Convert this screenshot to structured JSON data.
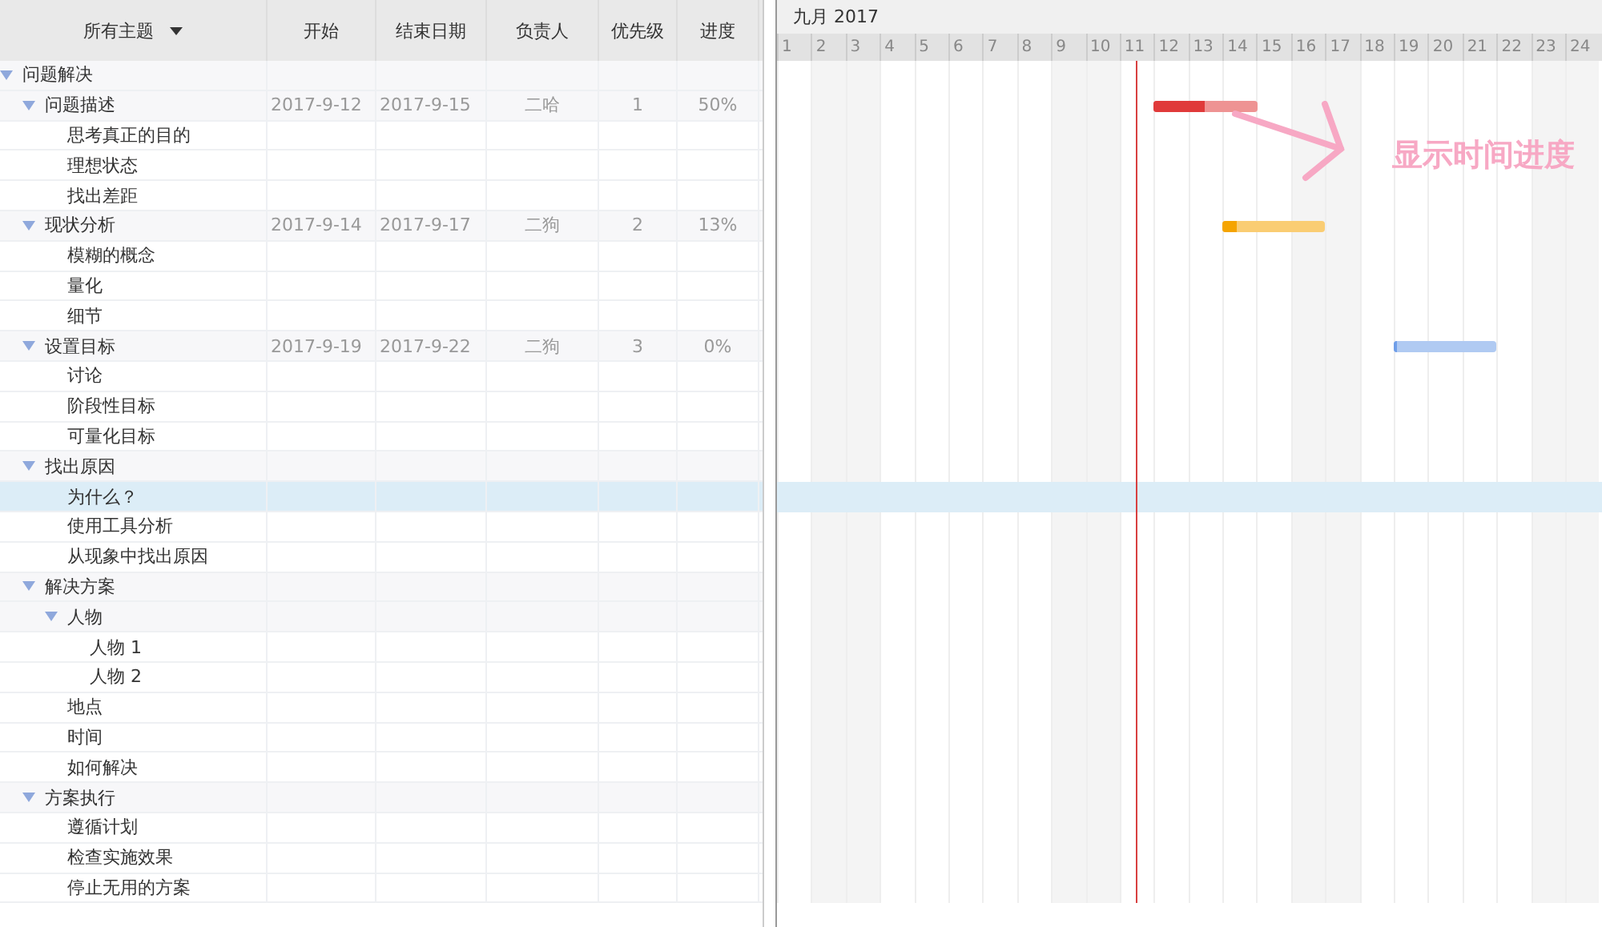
{
  "columns": [
    {
      "label": "所有主题",
      "menu": true
    },
    {
      "label": "开始"
    },
    {
      "label": "结束日期"
    },
    {
      "label": "负责人"
    },
    {
      "label": "优先级"
    },
    {
      "label": "进度"
    }
  ],
  "rows": [
    {
      "name": "问题解决",
      "expanded": true,
      "selected": false,
      "children": [
        {
          "name": "问题描述",
          "expanded": true,
          "selected": false,
          "start": "2017-9-12",
          "end": "2017-9-15",
          "owner": "二哈",
          "priority": "1",
          "progress": "50%",
          "bar": {
            "level": 0.5,
            "color": "#e03a3a"
          },
          "children": [
            {
              "name": "思考真正的目的",
              "selected": false
            },
            {
              "name": "理想状态",
              "selected": false
            },
            {
              "name": "找出差距",
              "selected": false
            }
          ]
        },
        {
          "name": "现状分析",
          "expanded": true,
          "selected": false,
          "start": "2017-9-14",
          "end": "2017-9-17",
          "owner": "二狗",
          "priority": "2",
          "progress": "13%",
          "bar": {
            "level": 0.13,
            "color": "#f5a400"
          },
          "children": [
            {
              "name": " 模糊的概念",
              "selected": false
            },
            {
              "name": "量化",
              "selected": false
            },
            {
              "name": "细节",
              "selected": false
            }
          ]
        },
        {
          "name": "设置目标",
          "expanded": true,
          "selected": false,
          "start": "2017-9-19",
          "end": "2017-9-22",
          "owner": "二狗",
          "priority": "3",
          "progress": "0%",
          "bar": {
            "level": 0,
            "color": "#6f9ee8"
          },
          "children": [
            {
              "name": "讨论",
              "selected": false
            },
            {
              "name": "阶段性目标",
              "selected": false
            },
            {
              "name": "可量化目标",
              "selected": false
            }
          ]
        },
        {
          "name": "找出原因",
          "expanded": true,
          "selected": false,
          "children": [
            {
              "name": "为什么？",
              "selected": true
            },
            {
              "name": "使用工具分析",
              "selected": false
            },
            {
              "name": "从现象中找出原因",
              "selected": false
            }
          ]
        },
        {
          "name": "解决方案",
          "expanded": true,
          "selected": false,
          "children": [
            {
              "name": "人物",
              "expanded": true,
              "selected": false,
              "children": [
                {
                  "name": "人物 1",
                  "selected": false
                },
                {
                  "name": "人物 2",
                  "selected": false
                }
              ]
            },
            {
              "name": "地点",
              "selected": false
            },
            {
              "name": "时间",
              "selected": false
            },
            {
              "name": "如何解决",
              "selected": false
            }
          ]
        },
        {
          "name": "方案执行",
          "expanded": true,
          "selected": false,
          "children": [
            {
              "name": "遵循计划",
              "selected": false
            },
            {
              "name": "检查实施效果",
              "selected": false
            },
            {
              "name": "停止无用的方案",
              "selected": false
            }
          ]
        }
      ]
    }
  ],
  "gantt": {
    "month": "九月 2017",
    "days": [
      "1",
      "2",
      "3",
      "4",
      "5",
      "6",
      "7",
      "8",
      "9",
      "10",
      "11",
      "12",
      "13",
      "14",
      "15",
      "16",
      "17",
      "18",
      "19",
      "20",
      "21",
      "22",
      "23",
      "24"
    ]
  },
  "annotation": {
    "text": "显示时间进度"
  }
}
